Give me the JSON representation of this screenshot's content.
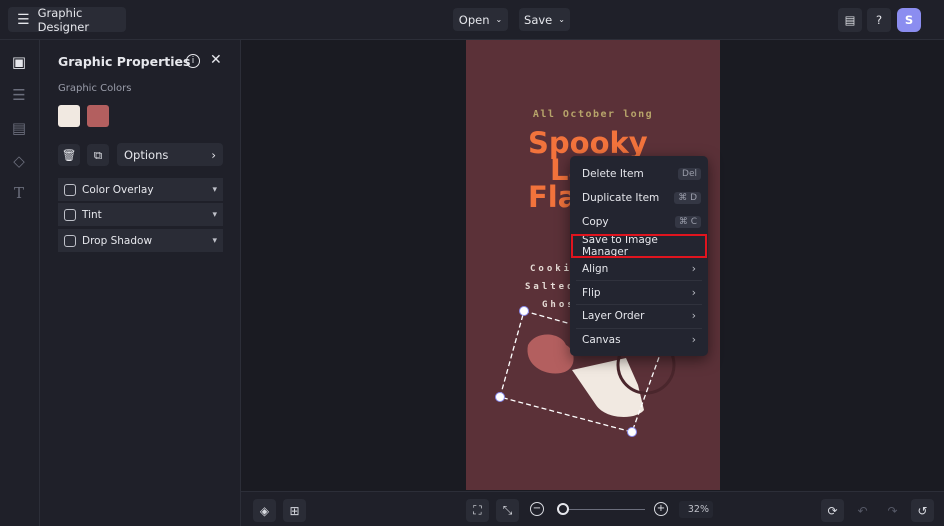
{
  "header": {
    "app_title": "Graphic Designer",
    "open_label": "Open",
    "save_label": "Save",
    "avatar_initial": "S"
  },
  "rail": {
    "items": [
      "image-icon",
      "sliders-icon",
      "layout-icon",
      "shapes-icon",
      "text-icon"
    ]
  },
  "panel": {
    "title": "Graphic Properties",
    "colors_label": "Graphic Colors",
    "colors": [
      "#f1e9e1",
      "#b35f5f"
    ],
    "options_label": "Options",
    "effects": [
      {
        "label": "Color Overlay",
        "checked": false
      },
      {
        "label": "Tint",
        "checked": false
      },
      {
        "label": "Drop Shadow",
        "checked": false
      }
    ]
  },
  "canvas_text": {
    "tagline": "All October long",
    "headline_1": "Spooky",
    "headline_2": "La",
    "headline_3": "Fla",
    "line_1": "Cooki",
    "line_2": "Salted",
    "line_3": "Ghos"
  },
  "context_menu": {
    "items": [
      {
        "label": "Delete Item",
        "shortcut": "Del"
      },
      {
        "label": "Duplicate Item",
        "shortcut": "⌘ D"
      },
      {
        "label": "Copy",
        "shortcut": "⌘ C"
      },
      {
        "label": "Save to Image Manager",
        "highlighted": true
      },
      {
        "label": "Align",
        "submenu": true
      },
      {
        "label": "Flip",
        "submenu": true
      },
      {
        "label": "Layer Order",
        "submenu": true
      },
      {
        "label": "Canvas",
        "submenu": true
      }
    ]
  },
  "bottom": {
    "zoom_percent": "32%",
    "zoom_value": 32
  },
  "colors": {
    "canvas": "#5b3138",
    "accent": "#8b8df0",
    "highlight": "#e0141e",
    "headline": "#f2733c",
    "tagline": "#b7a46a"
  }
}
